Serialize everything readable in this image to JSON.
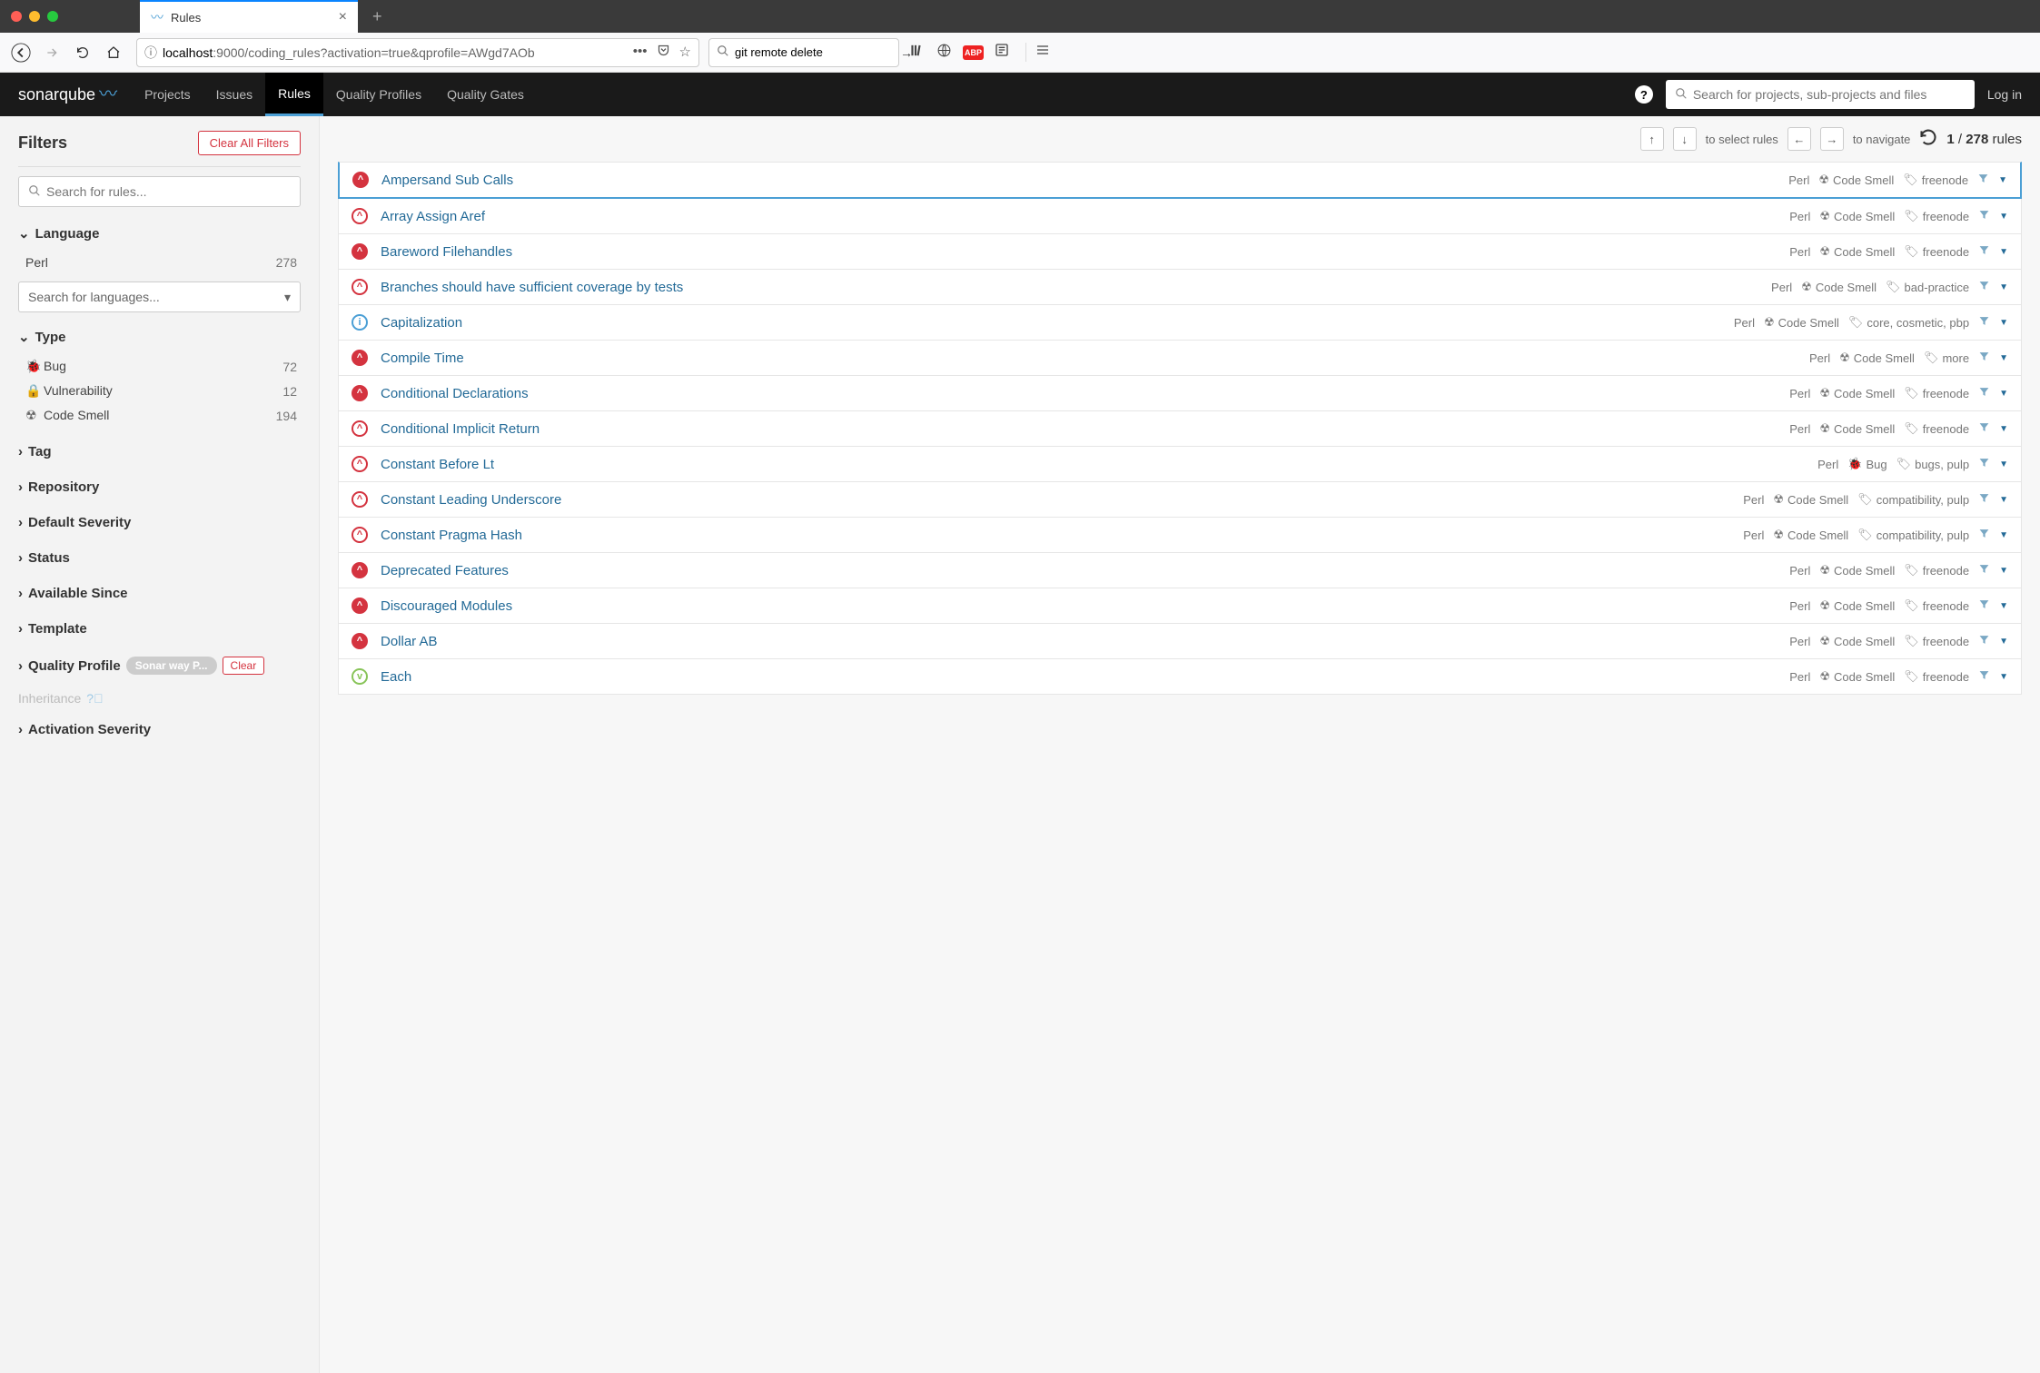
{
  "browser": {
    "tab_title": "Rules",
    "url_display_prefix": "localhost",
    "url_display_suffix": ":9000/coding_rules?activation=true&qprofile=AWgd7AOb",
    "search_value": "git remote delete"
  },
  "header": {
    "logo_text": "sonarqube",
    "nav": [
      "Projects",
      "Issues",
      "Rules",
      "Quality Profiles",
      "Quality Gates"
    ],
    "active_nav": 2,
    "search_placeholder": "Search for projects, sub-projects and files",
    "login_label": "Log in"
  },
  "sidebar": {
    "title": "Filters",
    "clear_all": "Clear All Filters",
    "search_placeholder": "Search for rules...",
    "language": {
      "header": "Language",
      "items": [
        {
          "label": "Perl",
          "count": "278"
        }
      ],
      "select_placeholder": "Search for languages..."
    },
    "type": {
      "header": "Type",
      "items": [
        {
          "icon": "bug",
          "label": "Bug",
          "count": "72"
        },
        {
          "icon": "lock",
          "label": "Vulnerability",
          "count": "12"
        },
        {
          "icon": "radiation",
          "label": "Code Smell",
          "count": "194"
        }
      ]
    },
    "collapsed_facets": [
      "Tag",
      "Repository",
      "Default Severity",
      "Status",
      "Available Since",
      "Template"
    ],
    "quality_profile": {
      "header": "Quality Profile",
      "pill": "Sonar way P...",
      "clear": "Clear"
    },
    "inheritance_label": "Inheritance",
    "activation_severity": "Activation Severity"
  },
  "rules_top": {
    "select_hint": "to select rules",
    "navigate_hint": "to navigate",
    "current": "1",
    "total": "278",
    "of_label": "rules"
  },
  "rules": [
    {
      "sev": "critical",
      "name": "Ampersand Sub Calls",
      "lang": "Perl",
      "type": "Code Smell",
      "tags": "freenode",
      "selected": true
    },
    {
      "sev": "major",
      "name": "Array Assign Aref",
      "lang": "Perl",
      "type": "Code Smell",
      "tags": "freenode"
    },
    {
      "sev": "critical",
      "name": "Bareword Filehandles",
      "lang": "Perl",
      "type": "Code Smell",
      "tags": "freenode"
    },
    {
      "sev": "major",
      "name": "Branches should have sufficient coverage by tests",
      "lang": "Perl",
      "type": "Code Smell",
      "tags": "bad-practice"
    },
    {
      "sev": "info",
      "name": "Capitalization",
      "lang": "Perl",
      "type": "Code Smell",
      "tags": "core, cosmetic, pbp"
    },
    {
      "sev": "critical",
      "name": "Compile Time",
      "lang": "Perl",
      "type": "Code Smell",
      "tags": "more"
    },
    {
      "sev": "critical",
      "name": "Conditional Declarations",
      "lang": "Perl",
      "type": "Code Smell",
      "tags": "freenode"
    },
    {
      "sev": "major",
      "name": "Conditional Implicit Return",
      "lang": "Perl",
      "type": "Code Smell",
      "tags": "freenode"
    },
    {
      "sev": "major",
      "name": "Constant Before Lt",
      "lang": "Perl",
      "type": "Bug",
      "tags": "bugs, pulp"
    },
    {
      "sev": "major",
      "name": "Constant Leading Underscore",
      "lang": "Perl",
      "type": "Code Smell",
      "tags": "compatibility, pulp"
    },
    {
      "sev": "major",
      "name": "Constant Pragma Hash",
      "lang": "Perl",
      "type": "Code Smell",
      "tags": "compatibility, pulp"
    },
    {
      "sev": "critical",
      "name": "Deprecated Features",
      "lang": "Perl",
      "type": "Code Smell",
      "tags": "freenode"
    },
    {
      "sev": "critical",
      "name": "Discouraged Modules",
      "lang": "Perl",
      "type": "Code Smell",
      "tags": "freenode"
    },
    {
      "sev": "critical",
      "name": "Dollar AB",
      "lang": "Perl",
      "type": "Code Smell",
      "tags": "freenode"
    },
    {
      "sev": "minor",
      "name": "Each",
      "lang": "Perl",
      "type": "Code Smell",
      "tags": "freenode"
    }
  ]
}
